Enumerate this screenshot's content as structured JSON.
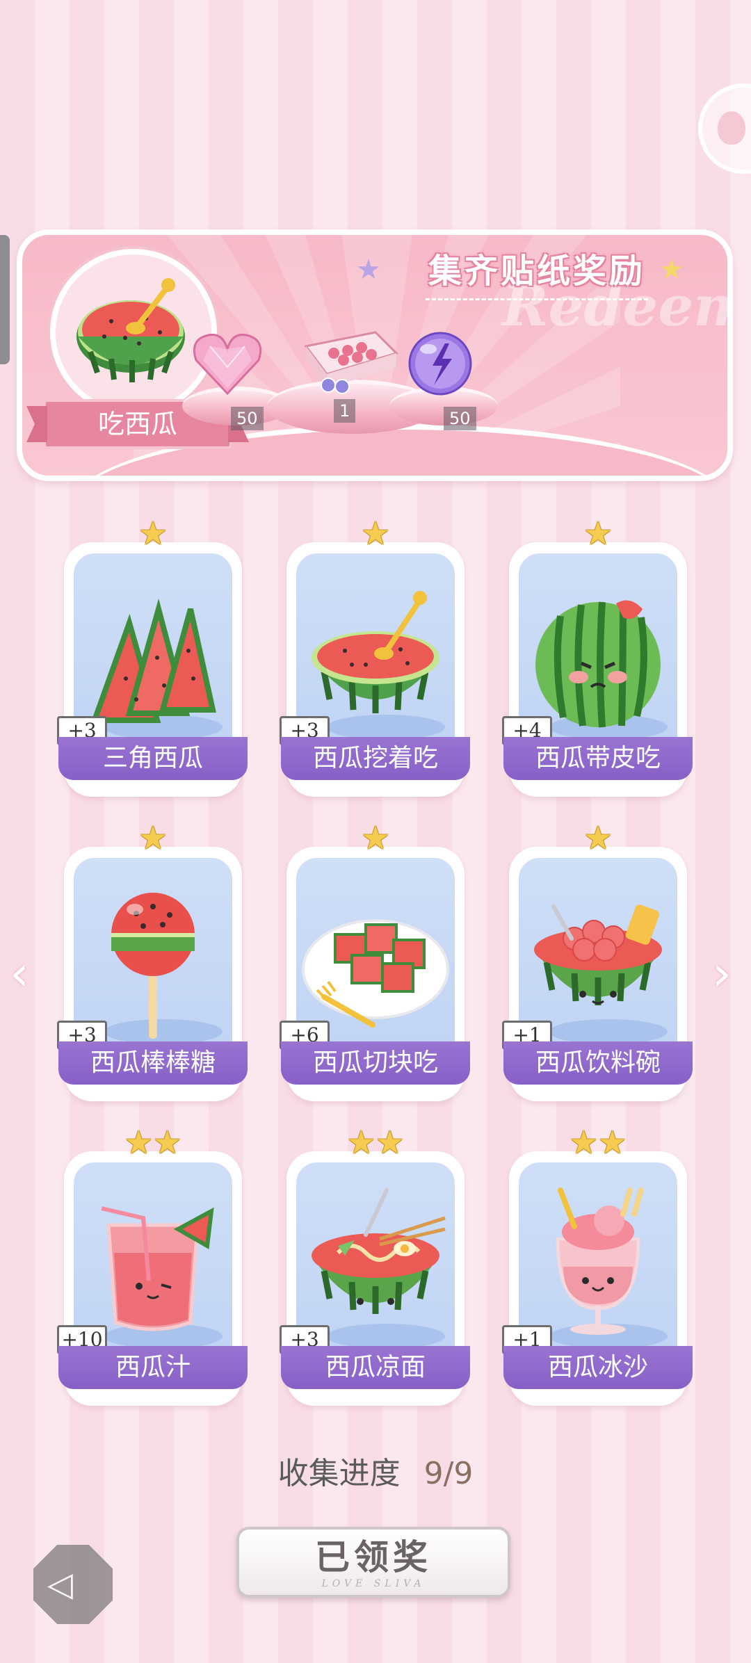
{
  "banner": {
    "title": "集齐贴纸奖励",
    "watermark": "Redeem",
    "current_item_label": "吃西瓜",
    "rewards": [
      {
        "name": "pink-heart-gem",
        "count": "50"
      },
      {
        "name": "gift-box",
        "count": "1"
      },
      {
        "name": "purple-energy-orb",
        "count": "50"
      }
    ]
  },
  "cards": [
    {
      "label": "三角西瓜",
      "bonus": "+3",
      "stars": "★",
      "icon": "watermelon-slices-icon"
    },
    {
      "label": "西瓜挖着吃",
      "bonus": "+3",
      "stars": "★",
      "icon": "watermelon-half-spoon-icon"
    },
    {
      "label": "西瓜带皮吃",
      "bonus": "+4",
      "stars": "★",
      "icon": "whole-watermelon-icon"
    },
    {
      "label": "西瓜棒棒糖",
      "bonus": "+3",
      "stars": "★",
      "icon": "watermelon-lollipop-icon"
    },
    {
      "label": "西瓜切块吃",
      "bonus": "+6",
      "stars": "★",
      "icon": "watermelon-cubes-icon"
    },
    {
      "label": "西瓜饮料碗",
      "bonus": "+1",
      "stars": "★",
      "icon": "watermelon-drink-bowl-icon"
    },
    {
      "label": "西瓜汁",
      "bonus": "+10",
      "stars": "★★",
      "icon": "watermelon-juice-icon"
    },
    {
      "label": "西瓜凉面",
      "bonus": "+3",
      "stars": "★★",
      "icon": "watermelon-cold-noodles-icon"
    },
    {
      "label": "西瓜冰沙",
      "bonus": "+1",
      "stars": "★★",
      "icon": "watermelon-smoothie-icon"
    }
  ],
  "progress": {
    "label": "收集进度",
    "value": "9/9"
  },
  "claim_button": {
    "label": "已领奖",
    "sub": "LOVE SLIVA"
  },
  "nav": {
    "prev": "‹",
    "next": "›"
  },
  "colors": {
    "accent": "#8660c6",
    "banner": "#f7b9c7",
    "star": "#f5cc4f"
  }
}
